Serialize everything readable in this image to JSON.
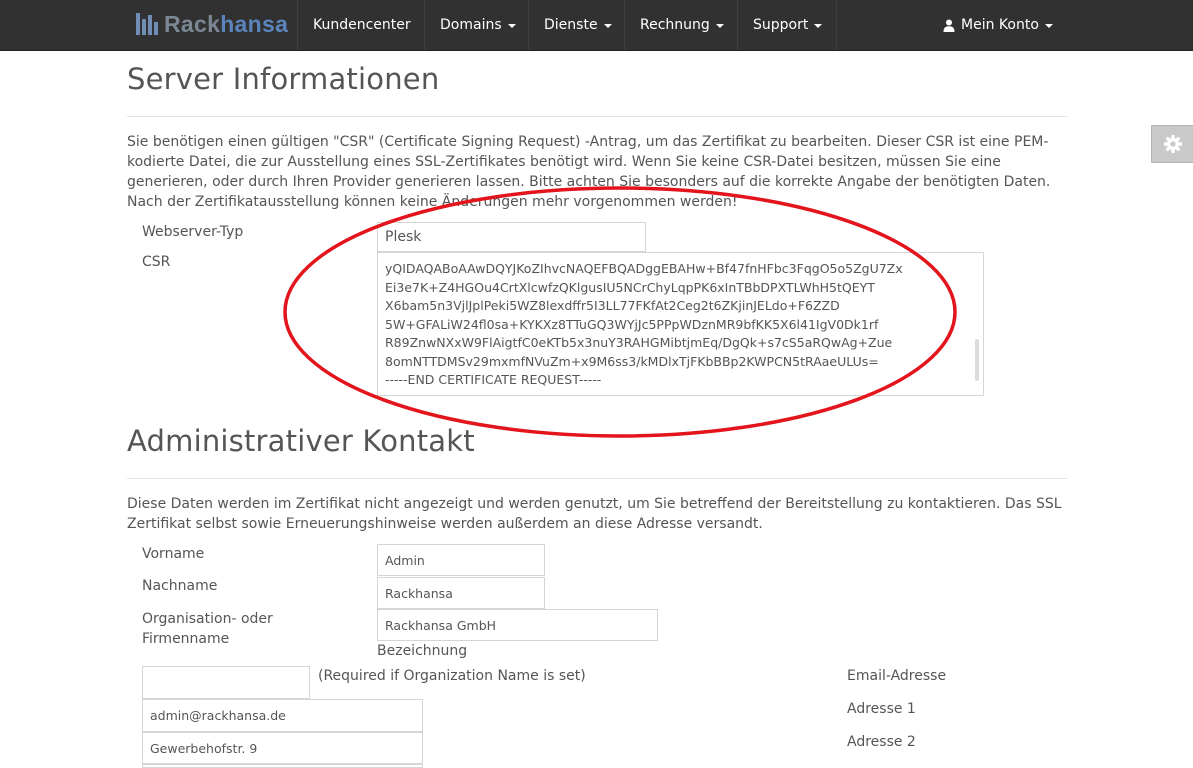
{
  "navbar": {
    "brand_part1": "Rack",
    "brand_part2": "hansa",
    "items": [
      {
        "label": "Kundencenter"
      },
      {
        "label": "Domains"
      },
      {
        "label": "Dienste"
      },
      {
        "label": "Rechnung"
      },
      {
        "label": "Support"
      }
    ],
    "account_label": "Mein Konto"
  },
  "server_section": {
    "title": "Server Informationen",
    "description": "Sie benötigen einen gültigen \"CSR\" (Certificate Signing Request) -Antrag, um das Zertifikat zu bearbeiten. Dieser CSR ist eine PEM-kodierte Datei, die zur Ausstellung eines SSL-Zertifikates benötigt wird. Wenn Sie keine CSR-Datei besitzen, müssen Sie eine generieren, oder durch Ihren Provider generieren lassen. Bitte achten Sie besonders auf die korrekte Angabe der benötigten Daten. Nach der Zertifikatausstellung können keine Änderungen mehr vorgenommen werden!",
    "webserver_label": "Webserver-Typ",
    "webserver_value": "Plesk",
    "csr_label": "CSR",
    "csr_lines": [
      "yQIDAQABoAAwDQYJKoZIhvcNAQEFBQADggEBAHw+Bf47fnHFbc3FqgO5o5ZgU7Zx",
      "Ei3e7K+Z4HGOu4CrtXlcwfzQKlgusIU5NCrChyLqpPK6xInTBbDPXTLWhH5tQEYT",
      "X6bam5n3VjlJplPeki5WZ8lexdffr5I3LL77FKfAt2Ceg2t6ZKjinJELdo+F6ZZD",
      "5W+GFALiW24fl0sa+KYKXz8TTuGQ3WYjJc5PPpWDznMR9bfKK5X6l41IgV0Dk1rf",
      "R89ZnwNXxW9FlAigtfC0eKTb5x3nuY3RAHGMibtjmEq/DgQk+s7cS5aRQwAg+Zue",
      "8omNTTDMSv29mxmfNVuZm+x9M6ss3/kMDlxTjFKbBBp2KWPCN5tRAaeULUs=",
      "-----END CERTIFICATE REQUEST-----"
    ]
  },
  "admin_section": {
    "title": "Administrativer Kontakt",
    "description": "Diese Daten werden im Zertifikat nicht angezeigt und werden genutzt, um Sie betreffend der Bereitstellung zu kontaktieren. Das SSL Zertifikat selbst sowie Erneuerungshinweise werden außerdem an diese Adresse versandt.",
    "vorname_label": "Vorname",
    "vorname_value": "Admin",
    "nachname_label": "Nachname",
    "nachname_value": "Rackhansa",
    "org_label_line1": "Organisation- oder",
    "org_label_line2": "Firmenname",
    "org_value": "Rackhansa GmbH",
    "bezeichnung_label": "Bezeichnung",
    "bezeichnung_value": "",
    "bezeichnung_hint": "(Required if Organization Name is set)",
    "email_label": "Email-Adresse",
    "email_value": "admin@rackhansa.de",
    "adresse1_label": "Adresse 1",
    "adresse1_value": "Gewerbehofstr. 9",
    "adresse2_label": "Adresse 2",
    "adresse2_value": ""
  },
  "colors": {
    "navbar_bg": "#313131",
    "brand_blue": "#5a84bb",
    "annotation_red": "#e3141b"
  },
  "icons": [
    "logo-bars-icon",
    "chevron-down-icon",
    "user-icon",
    "gear-icon"
  ]
}
